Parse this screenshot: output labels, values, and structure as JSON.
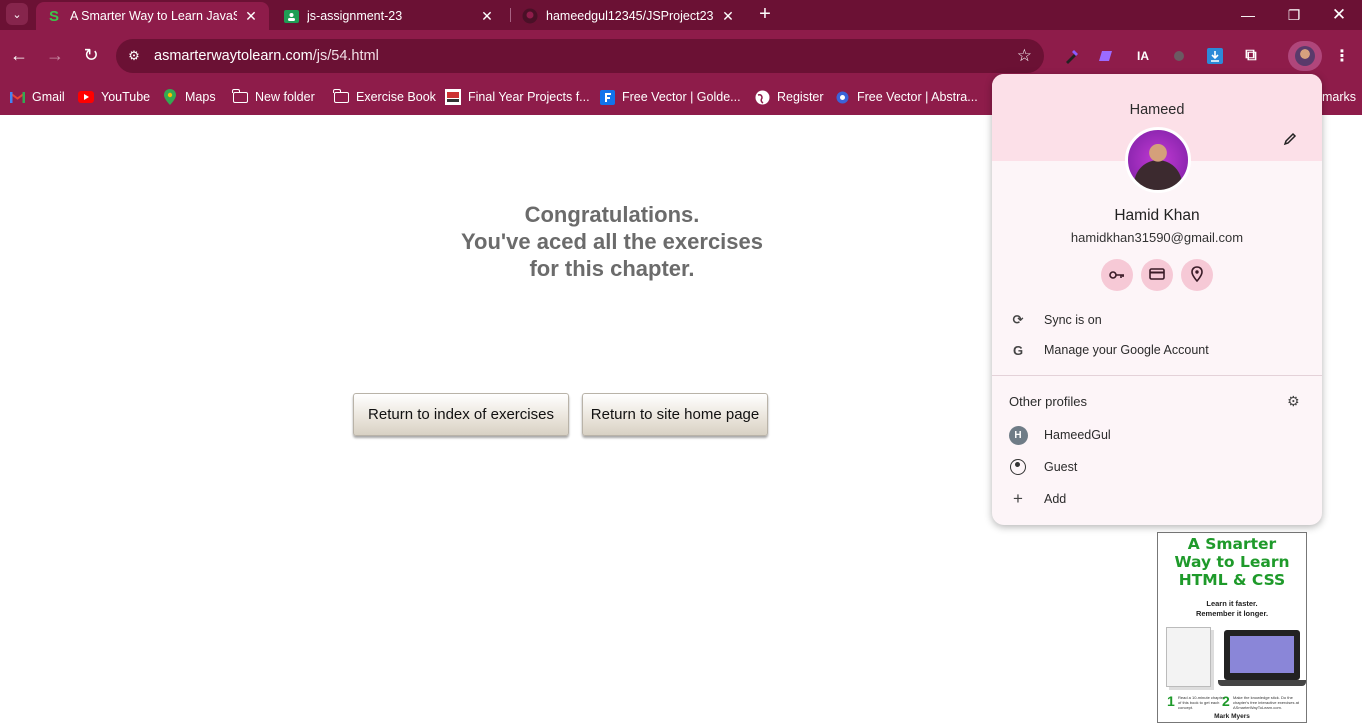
{
  "browser": {
    "tabs": [
      {
        "title": "A Smarter Way to Learn JavaScript",
        "favicon": "S",
        "active": true
      },
      {
        "title": "js-assignment-23",
        "favicon": "classroom-icon",
        "active": false
      },
      {
        "title": "hameedgul12345/JSProject23",
        "favicon": "github-icon",
        "active": false
      }
    ],
    "url_host": "asmarterwaytolearn.com",
    "url_path": "/js/54.html",
    "bookmarks": [
      {
        "label": "Gmail",
        "icon": "gmail-icon"
      },
      {
        "label": "YouTube",
        "icon": "youtube-icon"
      },
      {
        "label": "Maps",
        "icon": "maps-icon"
      },
      {
        "label": "New folder",
        "icon": "folder-icon"
      },
      {
        "label": "Exercise Book",
        "icon": "folder-icon"
      },
      {
        "label": "Final Year Projects f...",
        "icon": "site-icon"
      },
      {
        "label": "Free Vector | Golde...",
        "icon": "freepik-icon"
      },
      {
        "label": "Register",
        "icon": "globe-icon"
      },
      {
        "label": "Free Vector | Abstra...",
        "icon": "freepik-icon"
      }
    ],
    "bookmarks_overflow": "marks",
    "extension_label": "IA",
    "accent": "#8e1c4a",
    "tabstrip_color": "#6b1134"
  },
  "page": {
    "congrats": [
      "Congratulations.",
      "You've aced all the exercises",
      "for this chapter."
    ],
    "btn_index": "Return to index of exercises",
    "btn_home": "Return to site home page",
    "book_ad": {
      "title": [
        "A Smarter",
        "Way to Learn",
        "HTML & CSS"
      ],
      "tagline": [
        "Learn it faster.",
        "Remember it longer."
      ],
      "step1_num": "1",
      "step1_text": "Read a 10-minute chapter of this book to get each concept.",
      "step2_num": "2",
      "step2_text": "Make the knowledge stick. Do the chapter's free interactive exercises at ASmarterWayToLearn.com.",
      "author": "Mark Myers"
    }
  },
  "profile_menu": {
    "profile_name": "Hameed",
    "full_name": "Hamid Khan",
    "email": "hamidkhan31590@gmail.com",
    "sync": "Sync is on",
    "manage": "Manage your Google Account",
    "other_profiles": "Other profiles",
    "profiles": [
      {
        "name": "HameedGul",
        "badge": "H"
      },
      {
        "name": "Guest"
      },
      {
        "name": "Add"
      }
    ]
  }
}
